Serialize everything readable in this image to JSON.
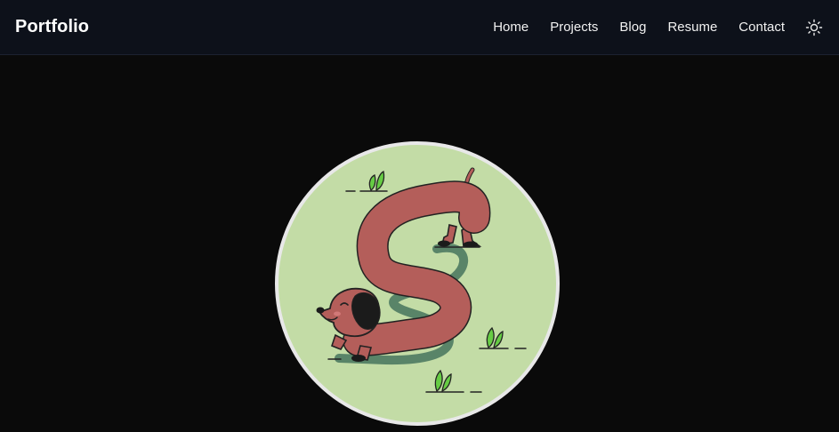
{
  "navbar": {
    "brand": "Portfolio",
    "links": [
      {
        "label": "Home"
      },
      {
        "label": "Projects"
      },
      {
        "label": "Blog"
      },
      {
        "label": "Resume"
      },
      {
        "label": "Contact"
      }
    ],
    "theme_toggle_icon": "sun-icon"
  },
  "hero": {
    "avatar_icon": "dachshund-illustration",
    "avatar_bg": "#c3dca6",
    "dog_color": "#b45e5a"
  },
  "colors": {
    "page_bg": "#0a0a0a",
    "nav_bg": "#0d111a",
    "nav_text": "#f1f1f1",
    "avatar_border": "#e8e8e8"
  }
}
